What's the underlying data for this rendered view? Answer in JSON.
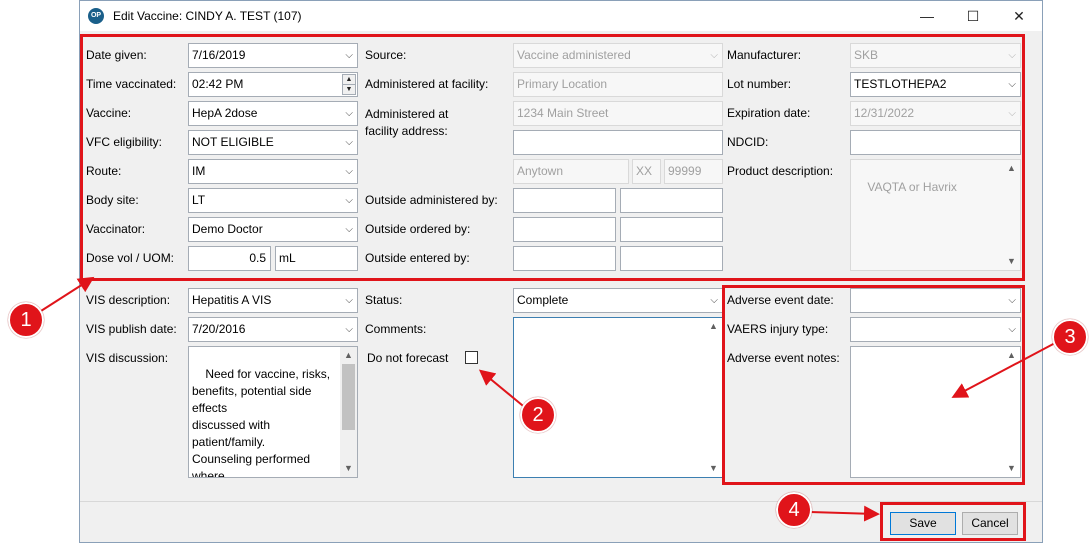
{
  "window": {
    "title": "Edit Vaccine: CINDY A. TEST (107)",
    "app_icon_text": "OP",
    "minimize": "—",
    "maximize": "☐",
    "close": "✕"
  },
  "left": {
    "date_given_label": "Date given:",
    "date_given_value": "7/16/2019",
    "time_label": "Time vaccinated:",
    "time_value": "02:42 PM",
    "vaccine_label": "Vaccine:",
    "vaccine_value": "HepA 2dose",
    "vfc_label": "VFC eligibility:",
    "vfc_value": "NOT ELIGIBLE",
    "route_label": "Route:",
    "route_value": "IM",
    "body_site_label": "Body site:",
    "body_site_value": "LT",
    "vaccinator_label": "Vaccinator:",
    "vaccinator_value": "Demo Doctor",
    "dose_label": "Dose vol / UOM:",
    "dose_value": "0.5",
    "uom_value": "mL"
  },
  "middle": {
    "source_label": "Source:",
    "source_value": "Vaccine administered",
    "facility_label": "Administered at facility:",
    "facility_value": "Primary Location",
    "facility_address_label": "Administered at\nfacility address:",
    "address_line1": "1234 Main Street",
    "address_line2": "",
    "city": "Anytown",
    "state": "XX",
    "zip": "99999",
    "outside_administered_label": "Outside administered by:",
    "outside_ordered_label": "Outside ordered by:",
    "outside_entered_label": "Outside entered by:"
  },
  "right": {
    "manufacturer_label": "Manufacturer:",
    "manufacturer_value": "SKB",
    "lot_label": "Lot number:",
    "lot_value": "TESTLOTHEPA2",
    "expiration_label": "Expiration date:",
    "expiration_value": "12/31/2022",
    "ndcid_label": "NDCID:",
    "ndcid_value": "",
    "product_desc_label": "Product description:",
    "product_desc_value": "VAQTA or Havrix"
  },
  "vis": {
    "description_label": "VIS description:",
    "description_value": "Hepatitis A VIS",
    "publish_label": "VIS publish date:",
    "publish_value": "7/20/2016",
    "discussion_label": "VIS discussion:",
    "discussion_value": "Need for vaccine, risks,\nbenefits, potential side\neffects\ndiscussed with\npatient/family.\nCounseling performed\nwhere"
  },
  "status": {
    "status_label": "Status:",
    "status_value": "Complete",
    "comments_label": "Comments:",
    "comments_value": "",
    "forecast_label": "Do not forecast"
  },
  "adverse": {
    "date_label": "Adverse event date:",
    "date_value": "",
    "vaers_label": "VAERS injury type:",
    "vaers_value": "",
    "notes_label": "Adverse event notes:",
    "notes_value": ""
  },
  "buttons": {
    "save": "Save",
    "cancel": "Cancel"
  },
  "callouts": [
    "1",
    "2",
    "3",
    "4"
  ],
  "colors": {
    "annotation_red": "#e0141a",
    "dialog_bg": "#f0f0f0"
  }
}
